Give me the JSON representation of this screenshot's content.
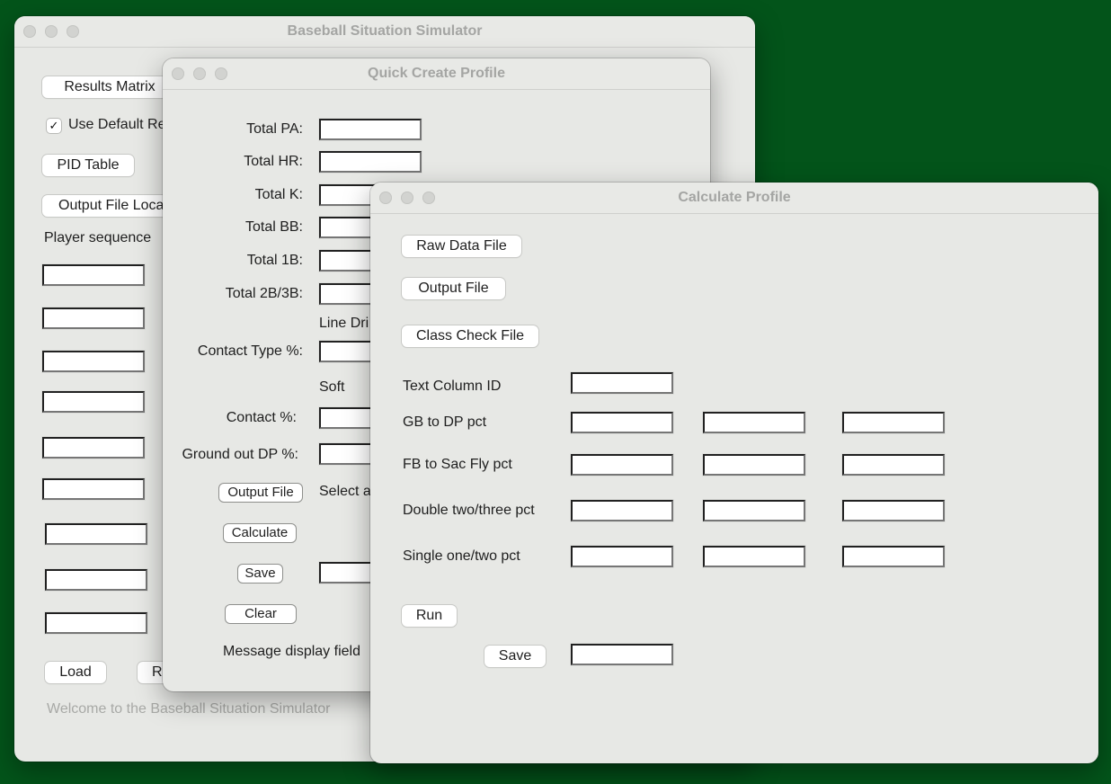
{
  "main_window": {
    "title": "Baseball Situation Simulator",
    "results_matrix_label": "Results Matrix",
    "use_default_checked": true,
    "use_default_label": "Use Default Re",
    "pid_table_label": "PID Table",
    "output_file_location_label": "Output File Loca",
    "player_sequence_label": "Player sequence",
    "player_fields": [
      "",
      "",
      "",
      "",
      "",
      "",
      "",
      "",
      ""
    ],
    "load_label": "Load",
    "run_label_partial": "R",
    "status_text": "Welcome to the Baseball Situation Simulator"
  },
  "quick_create": {
    "title": "Quick Create Profile",
    "total_pa_label": "Total PA:",
    "total_hr_label": "Total HR:",
    "total_k_label": "Total K:",
    "total_bb_label": "Total BB:",
    "total_1b_label": "Total 1B:",
    "total_2b3b_label": "Total 2B/3B:",
    "line_drive_label": "Line Dri",
    "contact_type_label": "Contact Type %:",
    "soft_label": "Soft",
    "contact_pct_label": "Contact %:",
    "ground_out_dp_label": "Ground out DP %:",
    "output_file_label": "Output File",
    "select_label": "Select a",
    "calculate_label": "Calculate",
    "save_label": "Save",
    "clear_label": "Clear",
    "message_label": "Message display field",
    "fields": {
      "total_pa": "",
      "total_hr": "",
      "total_k": "",
      "total_bb": "",
      "total_1b": "",
      "total_2b3b": "",
      "contact_type": "",
      "contact_pct": "",
      "ground_out_dp": "",
      "save_name": ""
    }
  },
  "calculate_profile": {
    "title": "Calculate Profile",
    "raw_data_file_label": "Raw Data File",
    "output_file_label": "Output File",
    "class_check_file_label": "Class Check File",
    "text_column_id_label": "Text Column ID",
    "text_column_id_value": "",
    "rows": [
      {
        "label": "GB to DP pct",
        "values": [
          "",
          "",
          ""
        ]
      },
      {
        "label": "FB to Sac Fly pct",
        "values": [
          "",
          "",
          ""
        ]
      },
      {
        "label": "Double two/three pct",
        "values": [
          "",
          "",
          ""
        ]
      },
      {
        "label": "Single one/two pct",
        "values": [
          "",
          "",
          ""
        ]
      }
    ],
    "run_label": "Run",
    "save_label": "Save",
    "save_name_value": ""
  }
}
